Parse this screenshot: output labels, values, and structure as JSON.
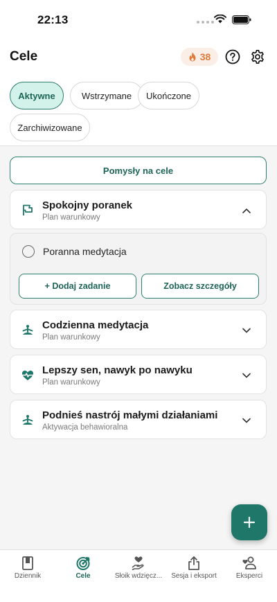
{
  "status_bar": {
    "time": "22:13"
  },
  "header": {
    "title": "Cele",
    "streak_count": "38"
  },
  "filters": [
    {
      "label": "Aktywne",
      "active": true
    },
    {
      "label": "Wstrzymane",
      "active": false
    },
    {
      "label": "Ukończone",
      "active": false
    },
    {
      "label": "Zarchiwizowane",
      "active": false
    }
  ],
  "main": {
    "ideas_button": "Pomysły na cele",
    "goals": [
      {
        "title": "Spokojny poranek",
        "subtitle": "Plan warunkowy",
        "icon": "flag-icon",
        "expanded": true
      },
      {
        "title": "Codzienna medytacja",
        "subtitle": "Plan warunkowy",
        "icon": "meditation-icon",
        "expanded": false
      },
      {
        "title": "Lepszy sen, nawyk po nawyku",
        "subtitle": "Plan warunkowy",
        "icon": "heartbeat-icon",
        "expanded": false
      },
      {
        "title": "Podnieś nastrój małymi działaniami",
        "subtitle": "Aktywacja behawioralna",
        "icon": "meditation-icon",
        "expanded": false
      }
    ],
    "expanded_goal": {
      "task": "Poranna medytacja",
      "add_task": "+ Dodaj zadanie",
      "details": "Zobacz szczegóły"
    }
  },
  "tabbar": [
    {
      "label": "Dziennik",
      "icon": "journal-icon",
      "active": false
    },
    {
      "label": "Cele",
      "icon": "target-icon",
      "active": true
    },
    {
      "label": "Słoik wdzięcz...",
      "icon": "gratitude-jar-icon",
      "active": false
    },
    {
      "label": "Sesja i eksport",
      "icon": "share-icon",
      "active": false
    },
    {
      "label": "Eksperci",
      "icon": "experts-icon",
      "active": false
    }
  ],
  "colors": {
    "accent": "#1e7769",
    "accent_light": "#d3f2ea",
    "streak": "#e07b39"
  }
}
